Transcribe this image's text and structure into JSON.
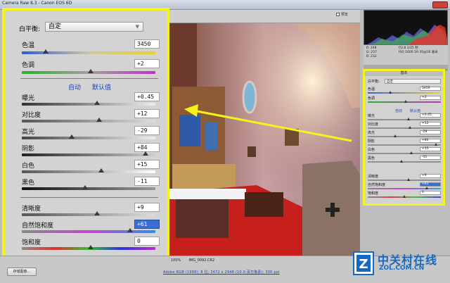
{
  "titlebar": {
    "title": "Camera Raw 8.3 - Canon EOS 6D"
  },
  "toolbar": {
    "preview_label": "预览"
  },
  "info": {
    "rgb": [
      "R: 248",
      "G: 237",
      "B: 232"
    ],
    "exposure": "f/2.8  1/25 秒",
    "iso": "ISO 1600  16-35@16 毫米"
  },
  "small_panel": {
    "header": "基本",
    "wb_label": "白平衡:",
    "wb_value": "自定",
    "rows": [
      {
        "label": "色温",
        "value": "3450"
      },
      {
        "label": "色调",
        "value": "+2"
      },
      {
        "label": "曝光",
        "value": "+0.45"
      },
      {
        "label": "对比度",
        "value": "+12"
      },
      {
        "label": "高光",
        "value": "-29"
      },
      {
        "label": "阴影",
        "value": "+84"
      },
      {
        "label": "白色",
        "value": "+15"
      },
      {
        "label": "黑色",
        "value": "-11"
      },
      {
        "label": "清晰度",
        "value": "+9"
      },
      {
        "label": "自然饱和度",
        "value": "+61"
      },
      {
        "label": "饱和度",
        "value": "0"
      }
    ],
    "auto": "自动",
    "default": "默认值"
  },
  "panel": {
    "wb_label": "白平衡:",
    "wb_value": "自定",
    "auto_label": "自动",
    "default_label": "默认值",
    "temp": {
      "label": "色温",
      "value": "3450"
    },
    "tint": {
      "label": "色调",
      "value": "+2"
    },
    "exposure": {
      "label": "曝光",
      "value": "+0.45"
    },
    "contrast": {
      "label": "对比度",
      "value": "+12"
    },
    "highlights": {
      "label": "高光",
      "value": "-29"
    },
    "shadows": {
      "label": "阴影",
      "value": "+84"
    },
    "whites": {
      "label": "白色",
      "value": "+15"
    },
    "blacks": {
      "label": "黑色",
      "value": "-11"
    },
    "clarity": {
      "label": "清晰度",
      "value": "+9"
    },
    "vibrance": {
      "label": "自然饱和度",
      "value": "+61"
    },
    "saturation": {
      "label": "饱和度",
      "value": "0"
    }
  },
  "status": {
    "zoom": "100%",
    "filename": "IMG_0092.CR2",
    "workflow": "Adobe RGB (1998); 8 位; 3472 x 2948 (10.0 百万像素); 300 ppi",
    "save_button": "存储图像..."
  },
  "watermark": {
    "cn": "中关村在线",
    "en": "ZOL.COM.CN"
  },
  "colors": {
    "highlight": "#f4f41a",
    "selection": "#3b6ed1",
    "link": "#1e46b8",
    "arrow": "#f4f41a"
  }
}
